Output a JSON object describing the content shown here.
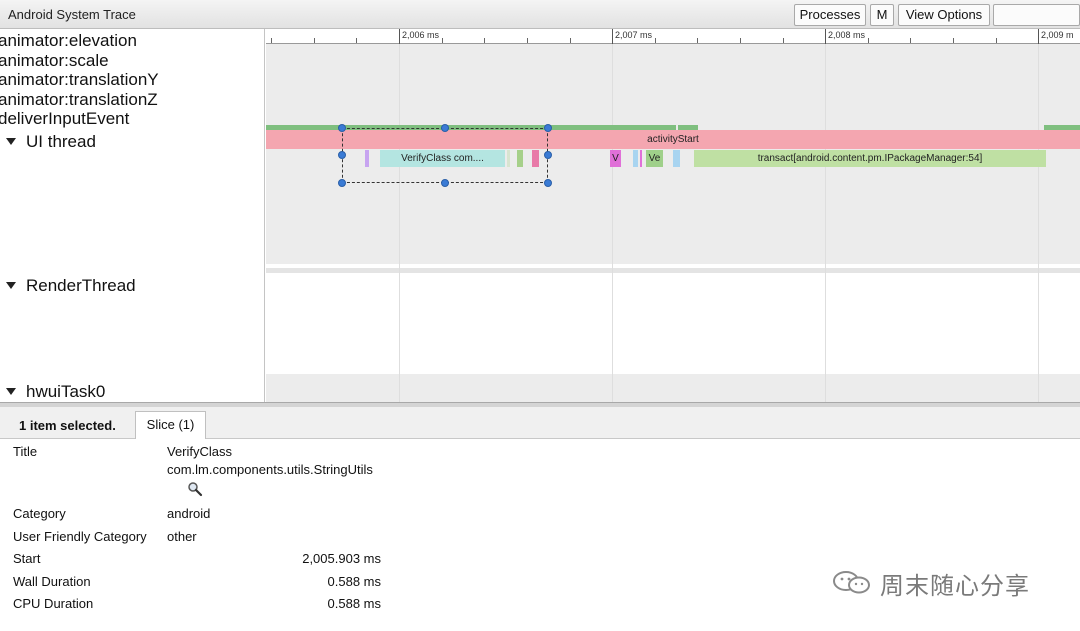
{
  "window": {
    "title": "Android System Trace"
  },
  "toolbar": {
    "processes": "Processes",
    "m": "M",
    "view_options": "View Options",
    "blank": ""
  },
  "tracks": {
    "slice_labels": [
      "animator:elevation",
      "animator:scale",
      "animator:translationY",
      "animator:translationZ",
      "deliverInputEvent"
    ],
    "threads": [
      "UI thread",
      "RenderThread",
      "hwuiTask0"
    ]
  },
  "ruler": {
    "ticks": [
      "2,006 ms",
      "2,007 ms",
      "2,008 ms",
      "2,009 m"
    ]
  },
  "timeline_slices": {
    "activity_start": "activityStart",
    "verify_class": "VerifyClass com....",
    "v": "V",
    "ve": "Ve",
    "transact": "transact[android.content.pm.IPackageManager:54]"
  },
  "panel": {
    "selected_count": "1 item selected.",
    "tab_slice": "Slice (1)",
    "rows": {
      "title_key": "Title",
      "title_value_line1": "VerifyClass",
      "title_value_line2": "com.lm.components.utils.StringUtils",
      "category_key": "Category",
      "category_value": "android",
      "friendly_key": "User Friendly Category",
      "friendly_value": "other",
      "start_key": "Start",
      "start_value": "2,005.903 ms",
      "wall_key": "Wall Duration",
      "wall_value": "0.588 ms",
      "cpu_key": "CPU Duration",
      "cpu_value": "0.588 ms"
    }
  },
  "watermark": {
    "text": "周末随心分享"
  },
  "colors": {
    "green_strip": "#7fbf7f",
    "pink_activity": "#f4a6b0",
    "teal_verify": "#b4e5e1",
    "green_transact": "#bfe0a3",
    "selection_handle": "#3a7bd5"
  }
}
